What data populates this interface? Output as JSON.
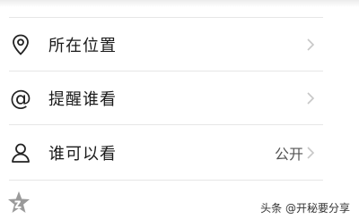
{
  "settings_list": {
    "items": [
      {
        "label": "所在位置",
        "icon": "location-pin-icon",
        "value": ""
      },
      {
        "label": "提醒谁看",
        "icon": "at-mention-icon",
        "value": ""
      },
      {
        "label": "谁可以看",
        "icon": "person-icon",
        "value": "公开"
      }
    ]
  },
  "at_symbol": "@",
  "watermark": {
    "text": "头条 @开秘要分享"
  },
  "colors": {
    "text": "#1a1a1a",
    "divider": "#e6e6e6",
    "chevron": "#c7c7c7",
    "value_text": "#555555"
  }
}
